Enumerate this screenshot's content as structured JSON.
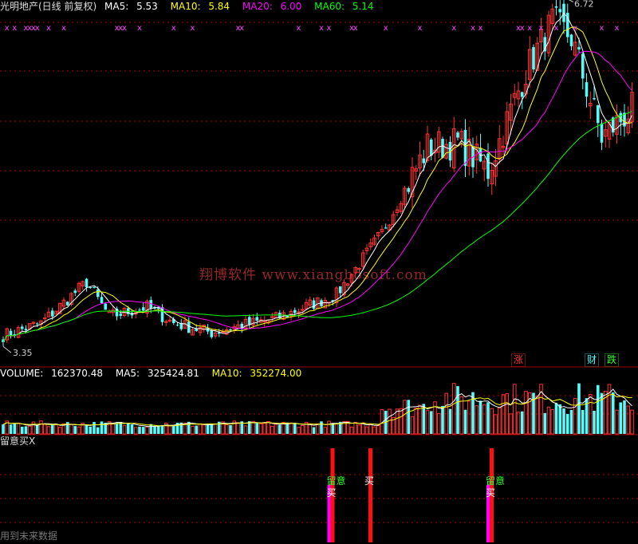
{
  "colors": {
    "up": "#ff3232",
    "down": "#54fcfc",
    "ma5": "#ffffff",
    "ma10": "#ffff00",
    "ma20": "#ff00ff",
    "ma60": "#00ff00",
    "grid": "#b00000",
    "flat": "#ffffff"
  },
  "price_panel": {
    "title": "光明地产(日线 前复权)",
    "ma5_label": "MA5:",
    "ma5_value": "5.53",
    "ma10_label": "MA10:",
    "ma10_value": "5.84",
    "ma20_label": "MA20:",
    "ma20_value": "6.00",
    "ma60_label": "MA60:",
    "ma60_value": "5.14",
    "high_label": "6.72",
    "low_label": "3.35",
    "watermark": "翔博软件 www.xiangbosoft.com",
    "event_up": "涨",
    "event_cai": "财",
    "event_down": "跌"
  },
  "volume_panel": {
    "label": "VOLUME:",
    "value": "162370.48",
    "ma5_label": "MA5:",
    "ma5_value": "325424.81",
    "ma10_label": "MA10:",
    "ma10_value": "352274.00"
  },
  "indicator_panel": {
    "title": "留意买X",
    "signal_watch": "留意",
    "signal_buy": "买",
    "footer": "用到未来数据"
  },
  "chart_data": [
    {
      "type": "candlestick",
      "title": "光明地产(日线 前复权)",
      "price_range": [
        3.35,
        6.72
      ],
      "ma_last": {
        "MA5": 5.53,
        "MA10": 5.84,
        "MA20": 6.0,
        "MA60": 5.14
      },
      "waypoints": [
        [
          0,
          3.42
        ],
        [
          10,
          3.55
        ],
        [
          22,
          3.98
        ],
        [
          28,
          3.62
        ],
        [
          38,
          3.72
        ],
        [
          45,
          3.55
        ],
        [
          55,
          3.45
        ],
        [
          60,
          3.5
        ],
        [
          72,
          3.6
        ],
        [
          88,
          3.85
        ],
        [
          100,
          4.5
        ],
        [
          112,
          5.4
        ],
        [
          120,
          5.45
        ],
        [
          128,
          5.15
        ],
        [
          138,
          6.2
        ],
        [
          145,
          6.72
        ],
        [
          150,
          6.55
        ],
        [
          158,
          5.5
        ],
        [
          166,
          5.8
        ]
      ],
      "n_bars": 167
    },
    {
      "type": "bar",
      "title": "VOLUME",
      "last": 162370.48,
      "ma5": 325424.81,
      "ma10": 352274.0
    },
    {
      "type": "signals",
      "title": "留意买X",
      "events": [
        {
          "bar": 86,
          "labels": [
            "留意",
            "买"
          ]
        },
        {
          "bar": 96,
          "labels": [
            "买"
          ]
        },
        {
          "bar": 128,
          "labels": [
            "留意",
            "买"
          ]
        }
      ]
    }
  ]
}
